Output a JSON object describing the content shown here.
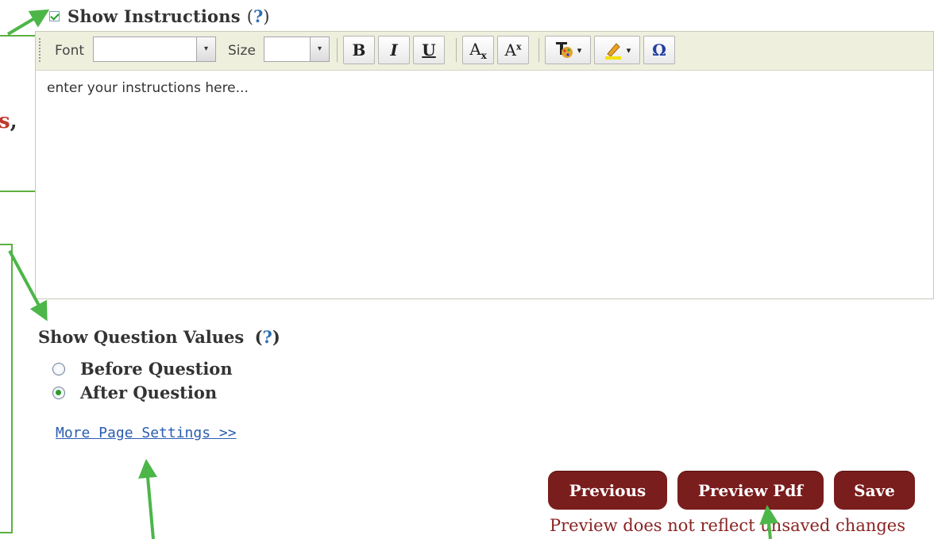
{
  "show_instructions": {
    "label": "Show Instructions",
    "help_open": "(",
    "help_q": "?",
    "help_close": ")",
    "checked": true
  },
  "toolbar": {
    "font_label": "Font",
    "size_label": "Size",
    "dropdown_glyph": "▾",
    "bold": "B",
    "italic": "I",
    "underline": "U",
    "subscript_base": "A",
    "subscript_mark": "x",
    "superscript_base": "A",
    "superscript_mark": "x",
    "caret": "▾",
    "special_char": "Ω"
  },
  "editor": {
    "content": "enter your instructions here..."
  },
  "question_values": {
    "title": "Show Question Values",
    "help_open": "(",
    "help_q": "?",
    "help_close": ")",
    "options": [
      "Before Question",
      "After Question"
    ],
    "selected": "After Question"
  },
  "more_link": "More Page Settings >>",
  "buttons": {
    "previous": "Previous",
    "preview": "Preview Pdf",
    "save": "Save"
  },
  "note": "Preview does not reflect unsaved changes",
  "callout": {
    "fragment": "s,"
  },
  "colors": {
    "accent_button": "#7a1d1d",
    "arrow": "#4cb648",
    "help": "#2d6fb7",
    "link": "#2a5db0",
    "note": "#8b2323"
  }
}
